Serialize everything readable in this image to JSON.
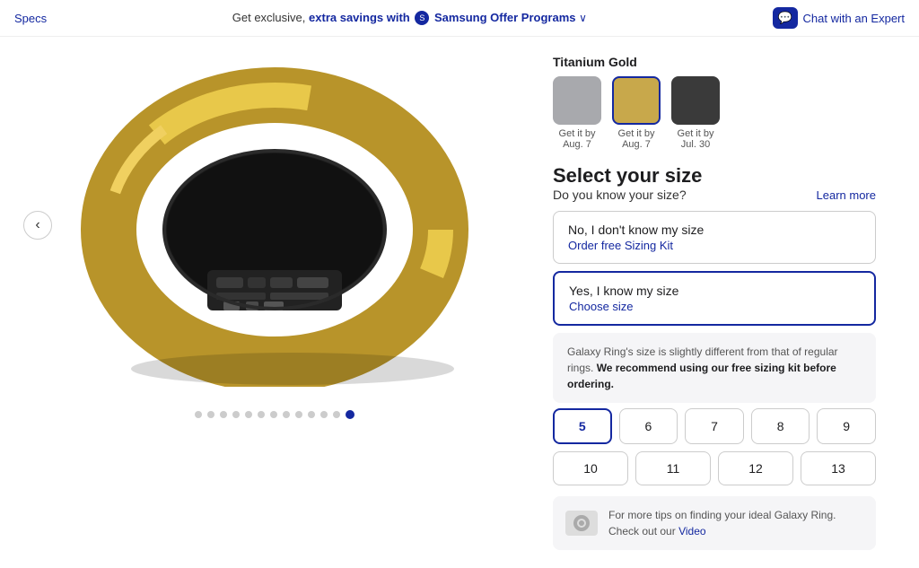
{
  "topbar": {
    "specs_link": "Specs",
    "promo_text": "Get exclusive,",
    "extra_savings": "extra savings with",
    "offer_program": "Samsung Offer Programs",
    "chat_label": "Chat with an Expert"
  },
  "product": {
    "selected_color_label": "Titanium Gold",
    "colors": [
      {
        "id": "silver",
        "swatch_class": "silver",
        "delivery_line1": "Get it by",
        "delivery_line2": "Aug. 7",
        "selected": false
      },
      {
        "id": "gold",
        "swatch_class": "gold",
        "delivery_line1": "Get it by",
        "delivery_line2": "Aug. 7",
        "selected": true
      },
      {
        "id": "black",
        "swatch_class": "black",
        "delivery_line1": "Get it by",
        "delivery_line2": "Jul. 30",
        "selected": false
      }
    ]
  },
  "size_section": {
    "title": "Select your size",
    "question": "Do you know your size?",
    "learn_more": "Learn more",
    "card_no_title": "No, I don't know my size",
    "card_no_link": "Order free Sizing Kit",
    "card_yes_title": "Yes, I know my size",
    "card_yes_link": "Choose size",
    "info_note": "Galaxy Ring's size is slightly different from that of regular rings.",
    "info_note_bold": "We recommend using our free sizing kit before ordering.",
    "sizes_row1": [
      "5",
      "6",
      "7",
      "8",
      "9"
    ],
    "sizes_row2": [
      "10",
      "11",
      "12",
      "13"
    ],
    "selected_size": "5",
    "tips_text": "For more tips on finding your ideal Galaxy Ring.",
    "tips_link_text": "Video",
    "tips_link_prefix": "Check out our"
  },
  "carousel": {
    "total_dots": 13,
    "active_dot": 12
  },
  "icons": {
    "chat": "💬",
    "prev": "‹",
    "samsung_badge": "S"
  }
}
